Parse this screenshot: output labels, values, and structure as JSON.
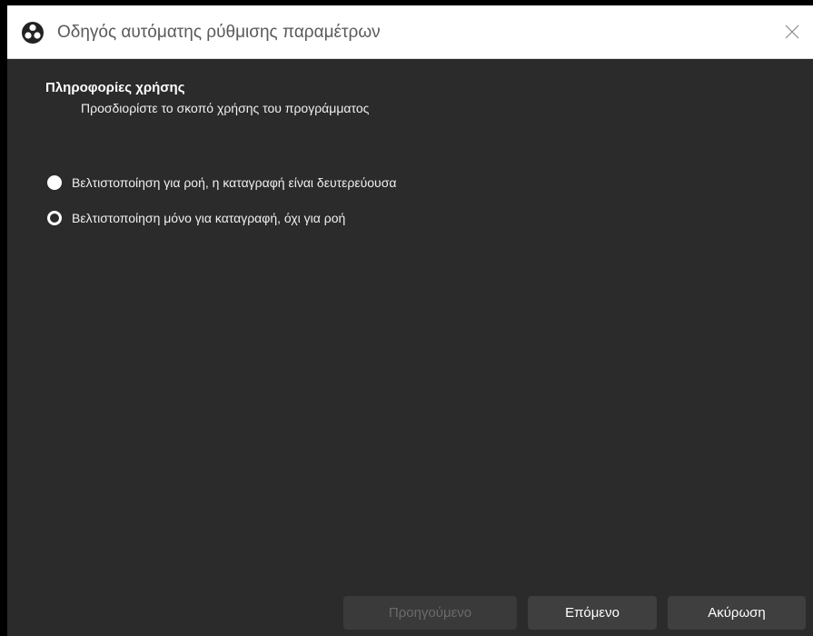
{
  "window": {
    "title": "Οδηγός αυτόματης ρύθμισης παραμέτρων",
    "app_icon": "obs-logo-icon",
    "close_icon": "close-icon"
  },
  "page": {
    "heading": "Πληροφορίες χρήσης",
    "subheading": "Προσδιορίστε το σκοπό χρήσης του προγράμματος"
  },
  "options": [
    {
      "label": "Βελτιστοποίηση για ροή, η καταγραφή είναι δευτερεύουσα",
      "checked": true
    },
    {
      "label": "Βελτιστοποίηση μόνο για καταγραφή, όχι για ροή",
      "checked": false
    }
  ],
  "buttons": {
    "previous": "Προηγούμενο",
    "previous_enabled": false,
    "next": "Επόμενο",
    "cancel": "Ακύρωση"
  },
  "colors": {
    "background": "#2b2b2b",
    "titlebar": "#ffffff",
    "button": "#3f3f3f",
    "button_disabled": "#3a3a3a",
    "text": "#f0f0f0",
    "text_disabled": "#6a6a6a"
  }
}
